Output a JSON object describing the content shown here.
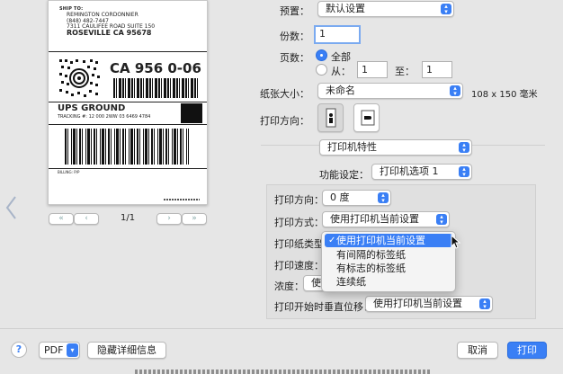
{
  "preview": {
    "ship_to_label": "SHIP TO:",
    "name": "REMINGTON CORDONNIER",
    "phone": "(848) 482-7447",
    "street": "7311 CAULIFEE ROAD SUITE 150",
    "city": "ROSEVILLE  CA 95678",
    "postal_code": "CA 956 0-06",
    "service": "UPS GROUND",
    "tracking": "TRACKING #: 12 000 2WW 03 6469 4784",
    "billing": "BILLING: P/P",
    "page_indicator": "1/1"
  },
  "form": {
    "preset_label": "预置：",
    "preset_value": "默认设置",
    "copies_label": "份数：",
    "copies_value": "1",
    "pages_label": "页数：",
    "pages_all": "全部",
    "pages_from": "从：",
    "pages_from_value": "1",
    "pages_to": "至：",
    "pages_to_value": "1",
    "paper_size_label": "纸张大小：",
    "paper_size_value": "未命名",
    "paper_size_dims": "108 x 150 毫米",
    "orientation_label": "打印方向：",
    "section_value": "打印机特性",
    "feature_set_label": "功能设定：",
    "feature_set_value": "打印机选项 1"
  },
  "options": {
    "direction_label": "打印方向：",
    "direction_value": "0 度",
    "method_label": "打印方式：",
    "method_value": "使用打印机当前设置",
    "paper_type_label": "打印纸类型",
    "speed_label": "打印速度：",
    "density_label": "浓度：",
    "density_value": "使",
    "vertical_offset_label": "打印开始时垂直位移：",
    "vertical_offset_value": "使用打印机当前设置"
  },
  "paper_type_menu": {
    "check": "✓",
    "items": [
      "使用打印机当前设置",
      "有间隔的标签纸",
      "有标志的标签纸",
      "连续纸"
    ]
  },
  "bottom": {
    "help": "?",
    "pdf": "PDF",
    "hide_details": "隐藏详细信息",
    "cancel": "取消",
    "print": "打印"
  }
}
